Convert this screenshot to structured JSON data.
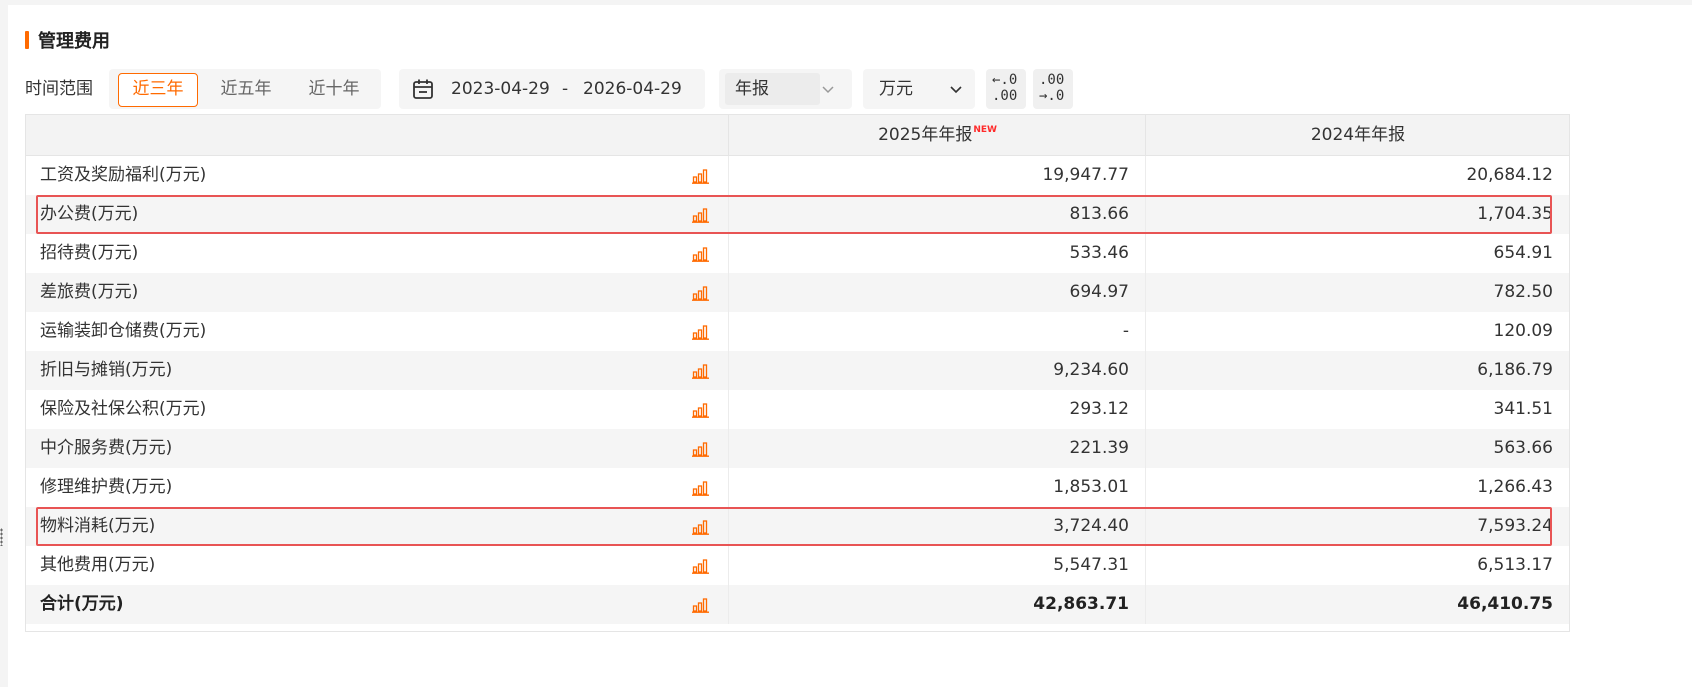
{
  "section": {
    "title": "管理费用"
  },
  "toolbar": {
    "range_label": "时间范围",
    "ranges": [
      "近三年",
      "近五年",
      "近十年"
    ],
    "active_range": "近三年",
    "date_start": "2023-04-29",
    "date_sep": "-",
    "date_end": "2026-04-29",
    "report_type": "年报",
    "unit": "万元",
    "dec_left": {
      "line1": "←.0",
      "line2": ".00"
    },
    "dec_right": {
      "line1": ".00",
      "line2": "→.0"
    }
  },
  "colors": {
    "accent": "#ff6a00",
    "highlight_border": "#e85454",
    "new_badge": "#ff2a2a"
  },
  "icons": {
    "date": "calendar-icon",
    "chevron": "chevron-down-icon",
    "chart": "bar-chart-icon"
  },
  "table": {
    "columns": [
      {
        "label": "2025年年报",
        "badge": "NEW"
      },
      {
        "label": "2024年年报",
        "badge": ""
      }
    ],
    "rows": [
      {
        "label": "工资及奖励福利(万元)",
        "v1": "19,947.77",
        "v2": "20,684.12"
      },
      {
        "label": "办公费(万元)",
        "v1": "813.66",
        "v2": "1,704.35"
      },
      {
        "label": "招待费(万元)",
        "v1": "533.46",
        "v2": "654.91"
      },
      {
        "label": "差旅费(万元)",
        "v1": "694.97",
        "v2": "782.50"
      },
      {
        "label": "运输装卸仓储费(万元)",
        "v1": "-",
        "v2": "120.09"
      },
      {
        "label": "折旧与摊销(万元)",
        "v1": "9,234.60",
        "v2": "6,186.79"
      },
      {
        "label": "保险及社保公积(万元)",
        "v1": "293.12",
        "v2": "341.51"
      },
      {
        "label": "中介服务费(万元)",
        "v1": "221.39",
        "v2": "563.66"
      },
      {
        "label": "修理维护费(万元)",
        "v1": "1,853.01",
        "v2": "1,266.43"
      },
      {
        "label": "物料消耗(万元)",
        "v1": "3,724.40",
        "v2": "7,593.24"
      },
      {
        "label": "其他费用(万元)",
        "v1": "5,547.31",
        "v2": "6,513.17"
      },
      {
        "label": "合计(万元)",
        "v1": "42,863.71",
        "v2": "46,410.75"
      }
    ]
  }
}
